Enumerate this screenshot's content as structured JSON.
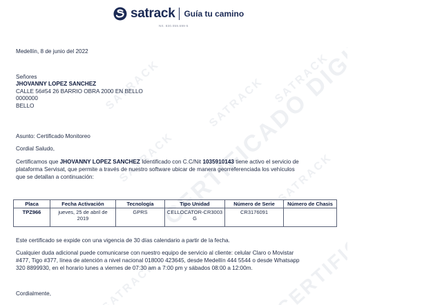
{
  "header": {
    "brand": "satrack",
    "tagline": "Guía tu camino",
    "doc_no": "NIt. 830.059.699-5"
  },
  "watermark": {
    "text": "SATRACK",
    "diagonal": "CERTIFICADO DIGITAL"
  },
  "letter": {
    "date": "Medellín, 8 de junio del 2022",
    "salutation": "Señores",
    "recipient_name": "JHOVANNY LOPEZ SANCHEZ",
    "address_line1": "CALLE 56#54 26 BARRIO OBRA 2000 EN BELLO",
    "address_line2": "0000000",
    "city": "BELLO",
    "subject": "Asunto: Certificado Monitoreo",
    "greeting": "Cordial Saludo,",
    "body": {
      "p1_pre": "Certificamos que ",
      "p1_name": "JHOVANNY LOPEZ SANCHEZ",
      "p1_mid": " Identificado con C.C/Nit ",
      "p1_id": "1035910143",
      "p1_post": " tiene activo el servicio de",
      "p1_line2": "plataforma Servisat, que permite a través de nuestro software ubicar de manera georreferenciada los vehículos",
      "p1_line3": "que se detallan a continuación:"
    },
    "validity": "Este certificado se expide con una vigencia de 30 días calendario a partir de la fecha.",
    "contact_line1": "Cualquier duda adicional puede comunicarse con nuestro equipo de servicio al cliente: celular Claro o Movistar",
    "contact_line2": "#477, Tigo #377, línea de atención a nivel nacional 018000 423645, desde Medellín 444 5544 o desde Whatsapp",
    "contact_line3": "320 8899930, en el horario lunes a viernes de 07:30 am a 7:00 pm y sábados 08:00 a 12:00m.",
    "closing": "Cordialmente,"
  },
  "vehicles_table": {
    "columns": [
      "Placa",
      "Fecha Activación",
      "Tecnología",
      "Tipo Unidad",
      "Número de Serie",
      "Número de Chasis"
    ],
    "rows": [
      [
        "TPZ966",
        "jueves, 25 de abril de 2019",
        "GPRS",
        "CELLOCATOR-CR3003G",
        "CR3176091",
        ""
      ]
    ]
  }
}
